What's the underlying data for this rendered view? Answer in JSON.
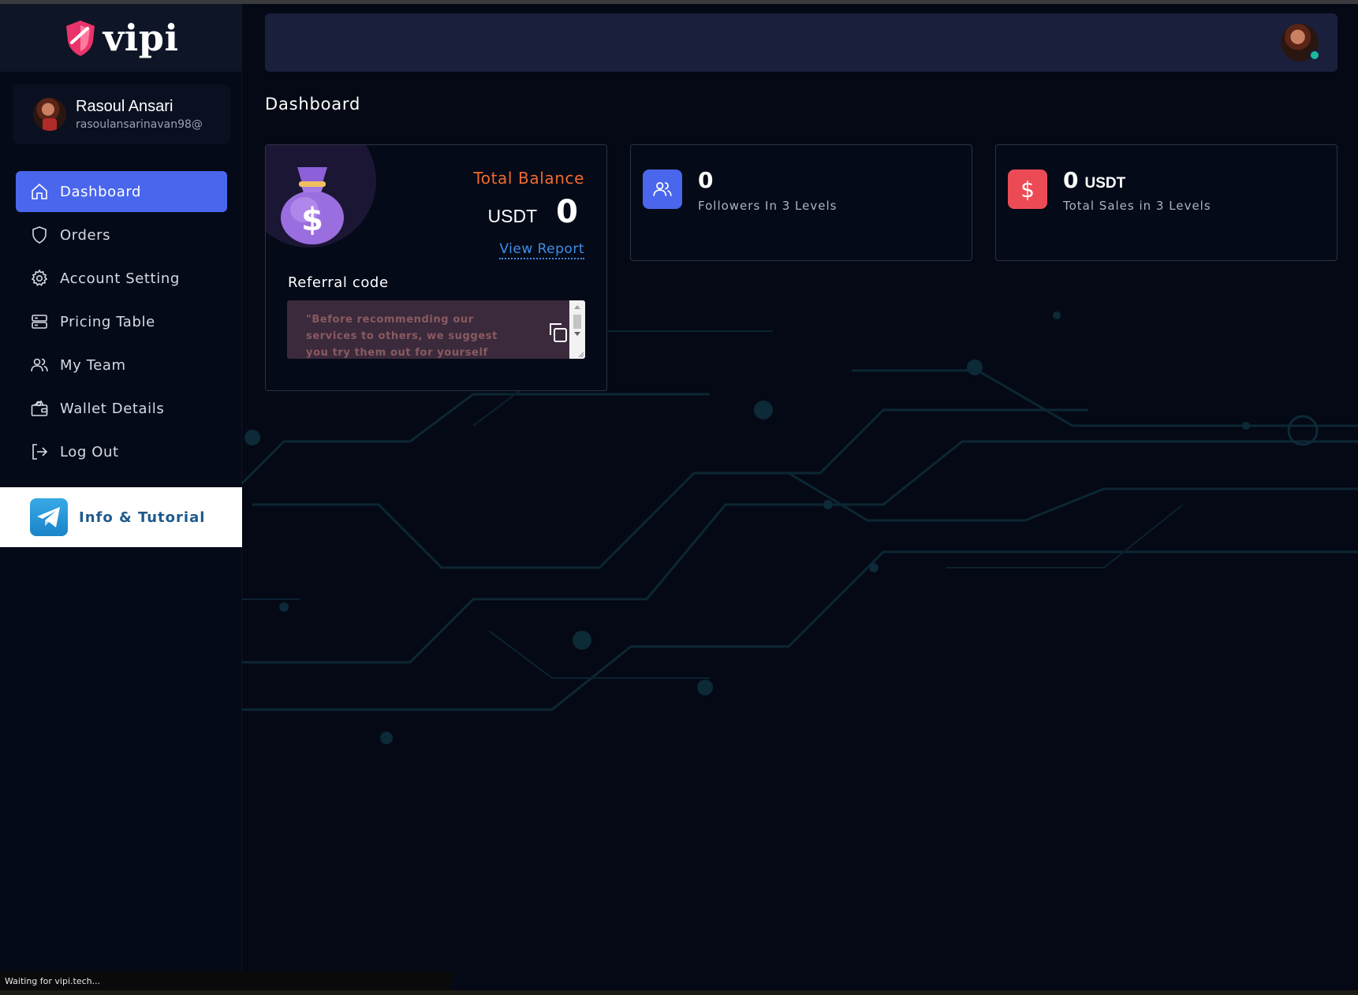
{
  "brand": {
    "name": "vipi",
    "logo_icon": "shield-logo-icon"
  },
  "user": {
    "name": "Rasoul Ansari",
    "email": "rasoulansarinavan98@"
  },
  "sidebar": {
    "items": [
      {
        "label": "Dashboard",
        "icon": "home-icon",
        "active": true
      },
      {
        "label": "Orders",
        "icon": "shield-icon"
      },
      {
        "label": "Account Setting",
        "icon": "gear-icon"
      },
      {
        "label": "Pricing Table",
        "icon": "server-icon"
      },
      {
        "label": "My Team",
        "icon": "users-icon"
      },
      {
        "label": "Wallet Details",
        "icon": "wallet-icon"
      },
      {
        "label": "Log Out",
        "icon": "logout-icon"
      }
    ],
    "info_tutorial": {
      "label": "Info & Tutorial",
      "icon": "telegram-icon"
    }
  },
  "page": {
    "title": "Dashboard"
  },
  "balance_card": {
    "label": "Total Balance",
    "currency": "USDT",
    "value": "0",
    "link": "View Report",
    "referral_label": "Referral code",
    "referral_text": "\"Before recommending our services to others, we suggest you try them out for yourself first.\""
  },
  "followers_card": {
    "value": "0",
    "caption": "Followers In 3 Levels"
  },
  "sales_card": {
    "value": "0",
    "unit": "USDT",
    "caption": "Total Sales in 3 Levels"
  },
  "status_bar": {
    "text": "Waiting for vipi.tech..."
  },
  "colors": {
    "accent": "#4a66ec",
    "balance_label": "#f06a2f",
    "link": "#3d8fe8",
    "sales_icon": "#ec4b55",
    "online": "#1fb89a"
  }
}
